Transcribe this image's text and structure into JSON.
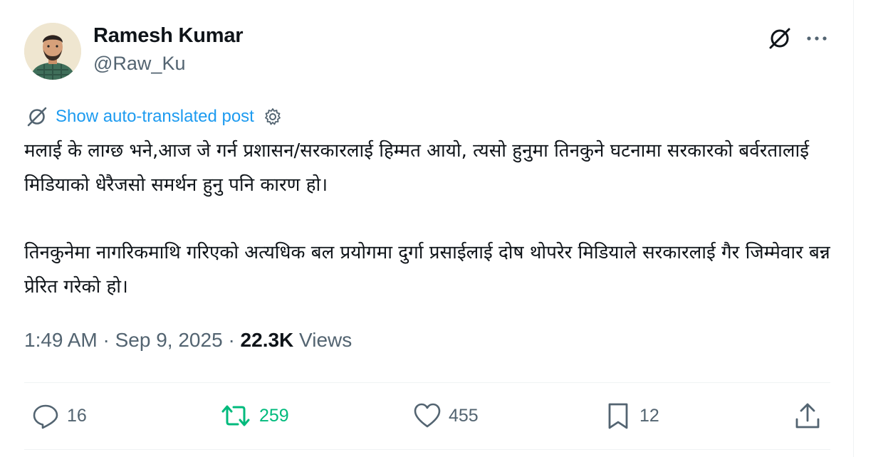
{
  "author": {
    "display_name": "Ramesh Kumar",
    "handle": "@Raw_Ku",
    "avatar_icon": "user-avatar"
  },
  "header_actions": {
    "grok_icon": "grok-icon",
    "more_icon": "more-horizontal-icon"
  },
  "translate": {
    "label": "Show auto-translated post",
    "icon": "grok-icon",
    "settings_icon": "gear-icon"
  },
  "post": {
    "paragraphs": [
      "मलाई के लाग्छ भने,आज जे गर्न प्रशासन/सरकारलाई हिम्मत आयो, त्यसो हुनुमा तिनकुने घटनामा सरकारको बर्वरतालाई मिडियाको धेरैजसो समर्थन हुनु पनि कारण हो।",
      "तिनकुनेमा नागरिकमाथि गरिएको अत्यधिक बल प्रयोगमा दुर्गा प्रसाईलाई दोष थोपरेर मिडियाले सरकारलाई गैर जिम्मेवार बन्न प्रेरित गरेको हो।"
    ]
  },
  "meta": {
    "time": "1:49 AM",
    "separator": "·",
    "date": "Sep 9, 2025",
    "views_count": "22.3K",
    "views_label": "Views"
  },
  "actions": {
    "replies": "16",
    "reposts": "259",
    "likes": "455",
    "bookmarks": "12",
    "accent_repost_color": "#00ba7c",
    "link_color": "#1d9bf0"
  }
}
